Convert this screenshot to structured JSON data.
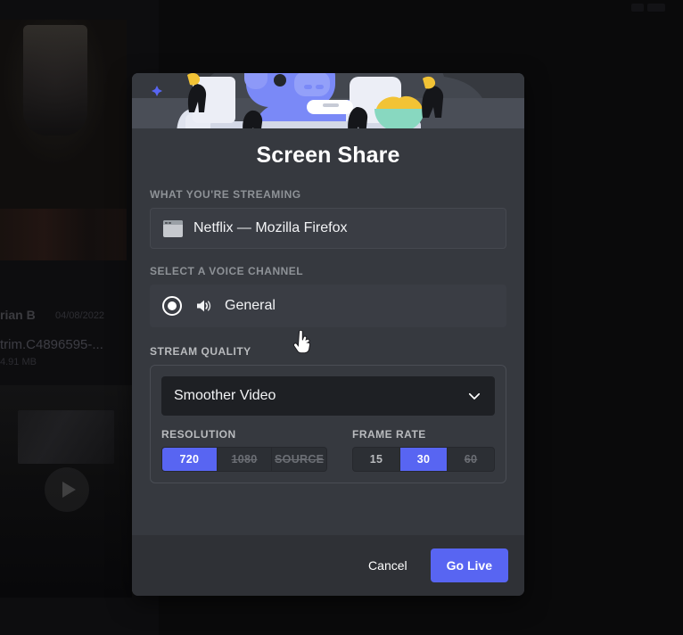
{
  "app": {
    "background": {
      "message_author": "rian B",
      "message_timestamp": "04/08/2022",
      "attachment_name": "trim.C4896595-...",
      "attachment_size": "4.91 MB",
      "play_icon": "play-icon"
    }
  },
  "dialog": {
    "title": "Screen Share",
    "close_icon": "close-icon",
    "hero_illustration": "screen-share-illustration",
    "streaming": {
      "label": "WHAT YOU'RE STREAMING",
      "source_icon": "window-icon",
      "source_name": "Netflix — Mozilla Firefox"
    },
    "voice_channel": {
      "label": "SELECT A VOICE CHANNEL",
      "radio_icon": "radio-selected-icon",
      "speaker_icon": "speaker-icon",
      "channel_name": "General",
      "selected": true
    },
    "stream_quality": {
      "label": "STREAM QUALITY",
      "preset_value": "Smoother Video",
      "preset_chevron_icon": "chevron-down-icon",
      "resolution": {
        "label": "RESOLUTION",
        "options": [
          {
            "label": "720",
            "state": "active"
          },
          {
            "label": "1080",
            "state": "disabled"
          },
          {
            "label": "SOURCE",
            "state": "disabled"
          }
        ]
      },
      "frame_rate": {
        "label": "FRAME RATE",
        "options": [
          {
            "label": "15",
            "state": "enabled"
          },
          {
            "label": "30",
            "state": "active"
          },
          {
            "label": "60",
            "state": "disabled"
          }
        ]
      }
    },
    "footer": {
      "cancel_label": "Cancel",
      "go_live_label": "Go Live"
    }
  },
  "colors": {
    "accent": "#5865f2",
    "modal_bg": "#36393f",
    "footer_bg": "#2f3136",
    "field_bg": "#3a3d44",
    "select_bg": "#1e2024",
    "text_primary": "#f2f3f5",
    "text_muted": "#b9bbbe",
    "label_muted": "#8e9297"
  }
}
